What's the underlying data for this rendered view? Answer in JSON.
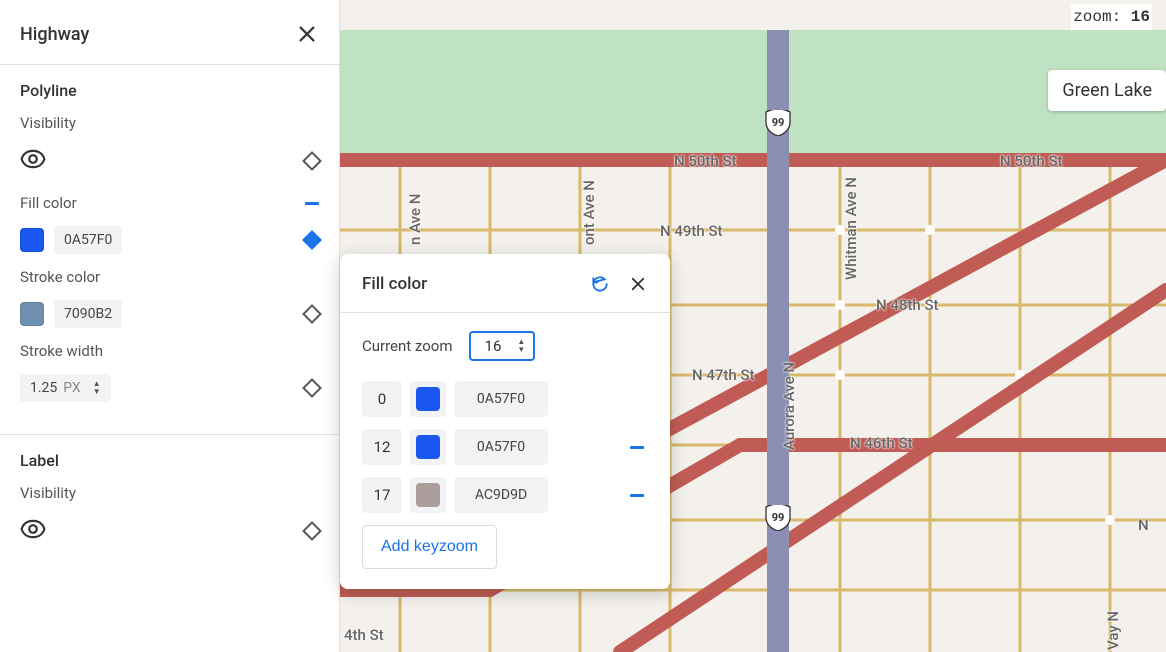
{
  "sidebar": {
    "title": "Highway",
    "polyline": {
      "section_label": "Polyline",
      "visibility_label": "Visibility",
      "fill_color_label": "Fill color",
      "fill_color_hex": "0A57F0",
      "fill_color_swatch": "#1A57F0",
      "stroke_color_label": "Stroke color",
      "stroke_color_hex": "7090B2",
      "stroke_color_swatch": "#7090B2",
      "stroke_width_label": "Stroke width",
      "stroke_width_value": "1.25",
      "stroke_width_unit": "PX"
    },
    "label_section": {
      "section_label": "Label",
      "visibility_label": "Visibility"
    }
  },
  "zoom_indicator": {
    "label": "zoom: ",
    "value": "16"
  },
  "map": {
    "place_label": "Green Lake",
    "route_99": "99",
    "streets": {
      "n50th": "N 50th St",
      "n50th_r": "N 50th St",
      "n49th": "N 49th St",
      "n48th": "N 48th St",
      "n47th": "N 47th St",
      "n46th": "N 46th St",
      "n4th": "4th St",
      "aurora": "Aurora Ave N",
      "whitman": "Whitman Ave N",
      "ont": "ont Ave N",
      "n_ave_n": "n Ave N",
      "vay_n": "Vay N",
      "n_side": "N"
    }
  },
  "popover": {
    "title": "Fill color",
    "current_zoom_label": "Current zoom",
    "current_zoom_value": "16",
    "keyzooms": [
      {
        "zoom": "0",
        "hex": "0A57F0",
        "swatch": "#1A57F0",
        "removable": false
      },
      {
        "zoom": "12",
        "hex": "0A57F0",
        "swatch": "#1A57F0",
        "removable": true
      },
      {
        "zoom": "17",
        "hex": "AC9D9D",
        "swatch": "#AC9D9D",
        "removable": true
      }
    ],
    "add_label": "Add keyzoom"
  }
}
